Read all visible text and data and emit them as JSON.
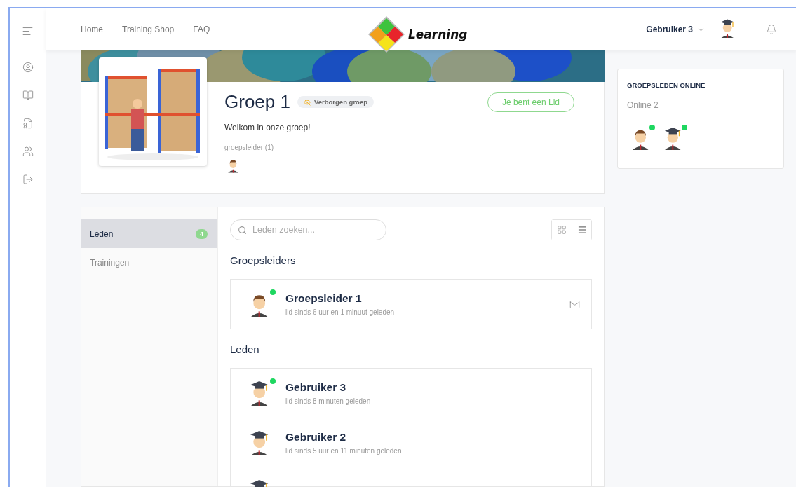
{
  "sidebar": {
    "items": [
      {
        "kind": "menu"
      },
      {
        "kind": "profile"
      },
      {
        "kind": "book"
      },
      {
        "kind": "certificate"
      },
      {
        "kind": "group"
      },
      {
        "kind": "logout"
      }
    ]
  },
  "header": {
    "nav": [
      "Home",
      "Training Shop",
      "FAQ"
    ],
    "logo_text": "Learning",
    "user": "Gebruiker 3"
  },
  "group": {
    "title": "Groep 1",
    "badge": "Verborgen groep",
    "membership_button": "Je bent een Lid",
    "description": "Welkom in onze groep!",
    "leaders_label": "groepsleider (1)",
    "leaders": [
      {
        "kind": "leader"
      }
    ]
  },
  "tabs": [
    {
      "label": "Leden",
      "count": "4",
      "selected": true
    },
    {
      "label": "Trainingen",
      "selected": false
    }
  ],
  "search": {
    "placeholder": "Leden zoeken..."
  },
  "view_toggle": [
    {
      "kind": "grid",
      "selected": false
    },
    {
      "kind": "list",
      "selected": true
    }
  ],
  "sections": [
    {
      "title": "Groepsleiders",
      "members": [
        {
          "name": "Groepsleider 1",
          "since": "lid sinds 6 uur en 1 minuut geleden",
          "kind": "leader",
          "online": true,
          "message": true
        }
      ]
    },
    {
      "title": "Leden",
      "members": [
        {
          "name": "Gebruiker 3",
          "since": "lid sinds 8 minuten geleden",
          "kind": "graduate",
          "online": true,
          "message": false
        },
        {
          "name": "Gebruiker 2",
          "since": "lid sinds 5 uur en 11 minuten geleden",
          "kind": "graduate",
          "online": false,
          "message": false
        },
        {
          "kind": "graduate",
          "online": false,
          "message": false
        }
      ]
    }
  ],
  "online_panel": {
    "title": "GROEPSLEDEN ONLINE",
    "count": "Online 2",
    "members": [
      {
        "kind": "leader",
        "online": true
      },
      {
        "kind": "graduate",
        "online": true
      }
    ]
  }
}
